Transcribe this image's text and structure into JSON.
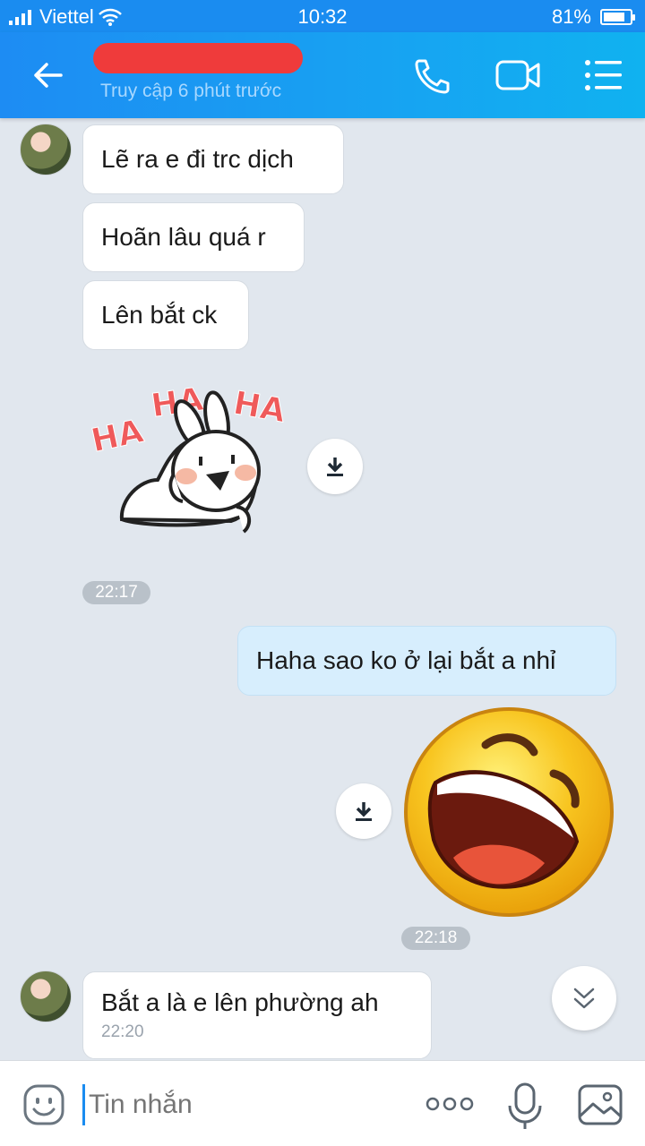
{
  "status_bar": {
    "carrier": "Viettel",
    "time": "10:32",
    "battery_percent": "81%",
    "battery_level": 0.81
  },
  "header": {
    "contact_status": "Truy cập 6 phút trước",
    "icons": [
      "back-arrow-icon",
      "phone-icon",
      "video-call-icon",
      "menu-list-icon"
    ]
  },
  "messages": {
    "in1": "Lẽ ra e đi trc dịch",
    "in2": "Hoãn lâu quá r",
    "in3": "Lên bắt ck",
    "sticker1_text": [
      "HA",
      "HA",
      "HA"
    ],
    "time1": "22:17",
    "out1": "Haha sao ko ở lại bắt a nhỉ",
    "time2": "22:18",
    "in4": "Bắt a là e lên phường ah",
    "in4_time": "22:20"
  },
  "input": {
    "placeholder": "Tin nhắn"
  },
  "colors": {
    "header": "#1d8cf3",
    "background": "#e1e7ee",
    "outgoing_bubble": "#d7eefd"
  }
}
